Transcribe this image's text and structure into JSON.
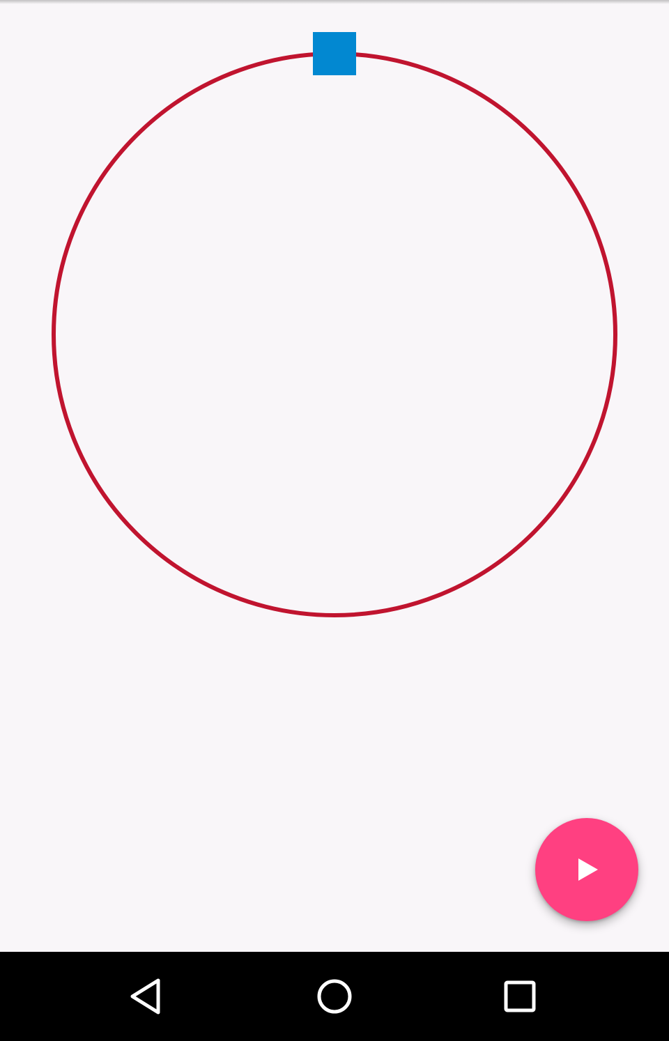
{
  "colors": {
    "background": "#f9f6f9",
    "orbit_ring": "#c0142f",
    "moving_square": "#0288d1",
    "fab": "#ff4081",
    "fab_icon": "#ffffff",
    "nav_bar": "#000000",
    "nav_icons": "#ffffff"
  },
  "animation": {
    "square_angle_deg": 0,
    "state": "stopped"
  },
  "fab": {
    "icon": "play-icon"
  },
  "navigation_bar": {
    "buttons": [
      {
        "icon": "back-triangle-icon"
      },
      {
        "icon": "home-circle-icon"
      },
      {
        "icon": "recents-square-icon"
      }
    ]
  }
}
